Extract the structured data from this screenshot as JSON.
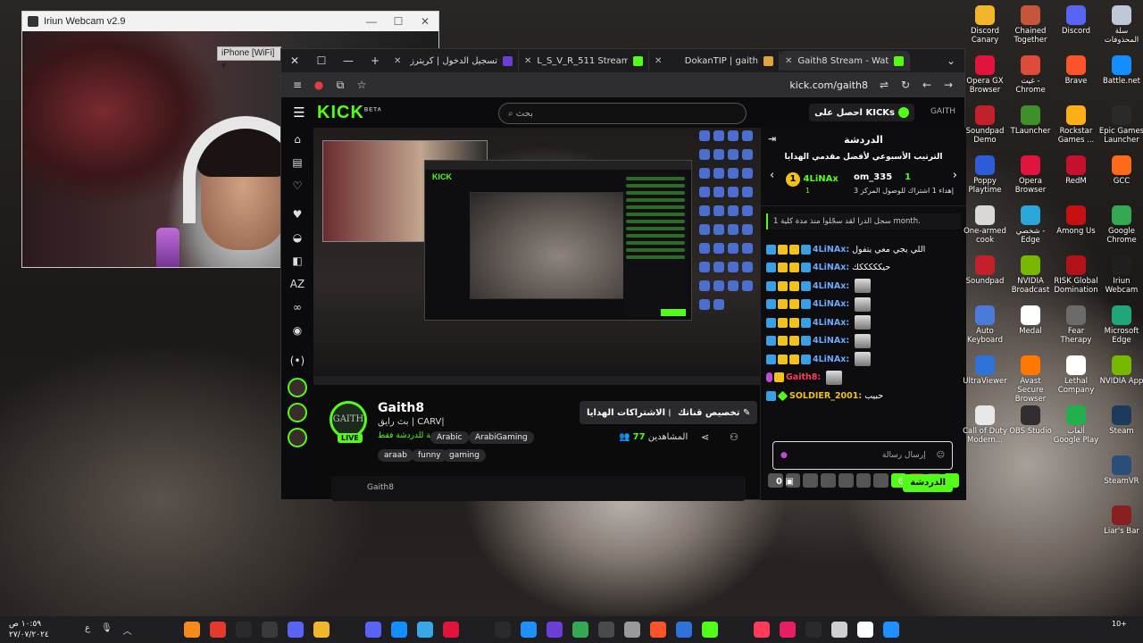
{
  "webcam": {
    "title": "Iriun Webcam v2.9",
    "device": "iPhone [WiFi]",
    "min": "—",
    "max": "☐",
    "close": "✕"
  },
  "browser": {
    "tabs": [
      {
        "label": "تسجيل الدخول | كريترز",
        "color": "#6a3fd6"
      },
      {
        "label": "L_S_V_R_511 Stream - Watch",
        "color": "#53fc18"
      },
      {
        "label": "DokanTIP | gaith",
        "color": "#e0a43a"
      },
      {
        "label": "Gaith8 Stream - Watch Live",
        "color": "#53fc18"
      }
    ],
    "url": "kick.com/gaith8",
    "new_tab": "+"
  },
  "kick": {
    "logo": "KICK",
    "logo_sup": "BETA",
    "search_placeholder": "بحث",
    "get_kicks": "احصل على KICKs",
    "header_user": "GAITH"
  },
  "channel": {
    "avatar_text": "GAITH",
    "live": "LIVE",
    "name": "Gaith8",
    "title": "بث رايق | CARV|",
    "subtitle": "مخصصة للدردشة فقط",
    "categories": [
      "ArabiGaming",
      "Arabic"
    ],
    "tags": [
      "gaming",
      "funny",
      "araab"
    ],
    "btn_subs": "الاشتراكات الهدايا",
    "btn_custom": "تخصيص قناتك",
    "viewers_label": "المشاهدين",
    "viewers_count": "77",
    "footer_user": "Gaith8"
  },
  "chat": {
    "title": "الدردشة",
    "leaderboard_title": "الترتيب الأسبوعي لأفضل مقدمي الهدايا",
    "lb_left_user": "4LiNAx",
    "lb_left_count": "1",
    "lb_right_user": "om_335",
    "lb_right_count": "1",
    "lb_coin": "1",
    "lb_sub": "إهداء 1 اشتراك للوصول المركز 3",
    "pinned": "سجل الدرا لقد سجّلوا منذ مدة كلية 1 month.",
    "messages": [
      {
        "user": "4LiNAx:",
        "text": "اللي يجي معي يتفول",
        "color": "#6aa8ff",
        "badges": [
          "b-blue",
          "b-crown",
          "b-crown",
          "b-blue"
        ],
        "emote": false
      },
      {
        "user": "4LiNAx:",
        "text": "حيكككككك",
        "color": "#6aa8ff",
        "badges": [
          "b-blue",
          "b-crown",
          "b-crown",
          "b-blue"
        ],
        "emote": false
      },
      {
        "user": "4LiNAx:",
        "text": "",
        "color": "#6aa8ff",
        "badges": [
          "b-blue",
          "b-crown",
          "b-crown",
          "b-blue"
        ],
        "emote": true
      },
      {
        "user": "4LiNAx:",
        "text": "",
        "color": "#6aa8ff",
        "badges": [
          "b-blue",
          "b-crown",
          "b-crown",
          "b-blue"
        ],
        "emote": true
      },
      {
        "user": "4LiNAx:",
        "text": "",
        "color": "#6aa8ff",
        "badges": [
          "b-blue",
          "b-crown",
          "b-crown",
          "b-blue"
        ],
        "emote": true
      },
      {
        "user": "4LiNAx:",
        "text": "",
        "color": "#6aa8ff",
        "badges": [
          "b-blue",
          "b-crown",
          "b-crown",
          "b-blue"
        ],
        "emote": true
      },
      {
        "user": "4LiNAx:",
        "text": "",
        "color": "#6aa8ff",
        "badges": [
          "b-blue",
          "b-crown",
          "b-crown",
          "b-blue"
        ],
        "emote": true
      },
      {
        "user": "Gaith8:",
        "text": "",
        "color": "#ff3b5c",
        "badges": [
          "b-mic",
          "b-crown"
        ],
        "emote": true
      },
      {
        "user": "SOLDIER_2001:",
        "text": "حبيب",
        "color": "#f3c11c",
        "badges": [
          "b-blue",
          "b-diamond"
        ],
        "emote": false
      }
    ],
    "input_placeholder": "إرسال رسالة",
    "send": "الدردشة",
    "kicks_count": "0"
  },
  "desktop_icons": [
    {
      "label": "Discord Canary",
      "color": "#f2b62a"
    },
    {
      "label": "Chained Together",
      "color": "#c6563b"
    },
    {
      "label": "Discord",
      "color": "#5865f2"
    },
    {
      "label": "سلة المحذوفات",
      "color": "#bfc8d6"
    },
    {
      "label": "Opera GX Browser",
      "color": "#e0143c"
    },
    {
      "label": "غيت - Chrome",
      "color": "#dd4b39"
    },
    {
      "label": "Brave",
      "color": "#fb542b"
    },
    {
      "label": "Battle.net",
      "color": "#148eff"
    },
    {
      "label": "Soundpad Demo",
      "color": "#c2202a"
    },
    {
      "label": "TLauncher",
      "color": "#3f8f2a"
    },
    {
      "label": "Rockstar Games ...",
      "color": "#fcaf17"
    },
    {
      "label": "Epic Games Launcher",
      "color": "#2a2a2a"
    },
    {
      "label": "Poppy Playtime",
      "color": "#2e5bd6"
    },
    {
      "label": "Opera Browser",
      "color": "#e0143c"
    },
    {
      "label": "RedM",
      "color": "#c7102e"
    },
    {
      "label": "GCC",
      "color": "#ff6a1a"
    },
    {
      "label": "One-armed cook",
      "color": "#d8d8d8"
    },
    {
      "label": "شخصي - Edge",
      "color": "#2aa7d8"
    },
    {
      "label": "Among Us",
      "color": "#c51111"
    },
    {
      "label": "Google Chrome",
      "color": "#34a853"
    },
    {
      "label": "Soundpad",
      "color": "#c2202a"
    },
    {
      "label": "NVIDIA Broadcast",
      "color": "#76b900"
    },
    {
      "label": "RISK Global Domination",
      "color": "#b3121b"
    },
    {
      "label": "Iriun Webcam",
      "color": "#1f1f1f"
    },
    {
      "label": "Auto Keyboard",
      "color": "#4b7bd8"
    },
    {
      "label": "Medal",
      "color": "#ffffff"
    },
    {
      "label": "Fear Therapy",
      "color": "#6b6b6b"
    },
    {
      "label": "Microsoft Edge",
      "color": "#1fa67a"
    },
    {
      "label": "UltraViewer",
      "color": "#2f72d8"
    },
    {
      "label": "Avast Secure Browser",
      "color": "#ff7800"
    },
    {
      "label": "Lethal Company",
      "color": "#ffffff"
    },
    {
      "label": "NVIDIA App",
      "color": "#76b900"
    },
    {
      "label": "Call of Duty Modern...",
      "color": "#e8e8e8"
    },
    {
      "label": "OBS Studio",
      "color": "#302e31"
    },
    {
      "label": "ألعاب Google Play",
      "color": "#21b04b"
    },
    {
      "label": "Steam",
      "color": "#1b3a5c"
    },
    {
      "label": "SteamVR",
      "color": "#2a4d7a"
    },
    {
      "label": "Liar's Bar",
      "color": "#8a1f1f"
    }
  ],
  "taskbar": {
    "time": "١٠:٥٩ ص",
    "date": "٢٧/٠٧/٢٠٢٤",
    "lang": "ع",
    "apps_colors": [
      "#f28b1b",
      "#e43a2c",
      "#2a2a2a",
      "#3a3a3a",
      "#5865f2",
      "#f2b62a",
      "#1f1f1f",
      "#5865f2",
      "#148eff",
      "#37a7e8",
      "#e0143c",
      "#1f1f1f",
      "#2a2a2a",
      "#1e90ff",
      "#6b3fd6",
      "#34a853",
      "#4a4a4a",
      "#9a9a9a",
      "#fb542b",
      "#2f72d8",
      "#53fc18",
      "#1f1f1f",
      "#ff3b5c",
      "#e81e63",
      "#2a2a2a",
      "#cfcfcf",
      "#ffffff",
      "#1e90ff"
    ],
    "notif_count": "10+"
  }
}
